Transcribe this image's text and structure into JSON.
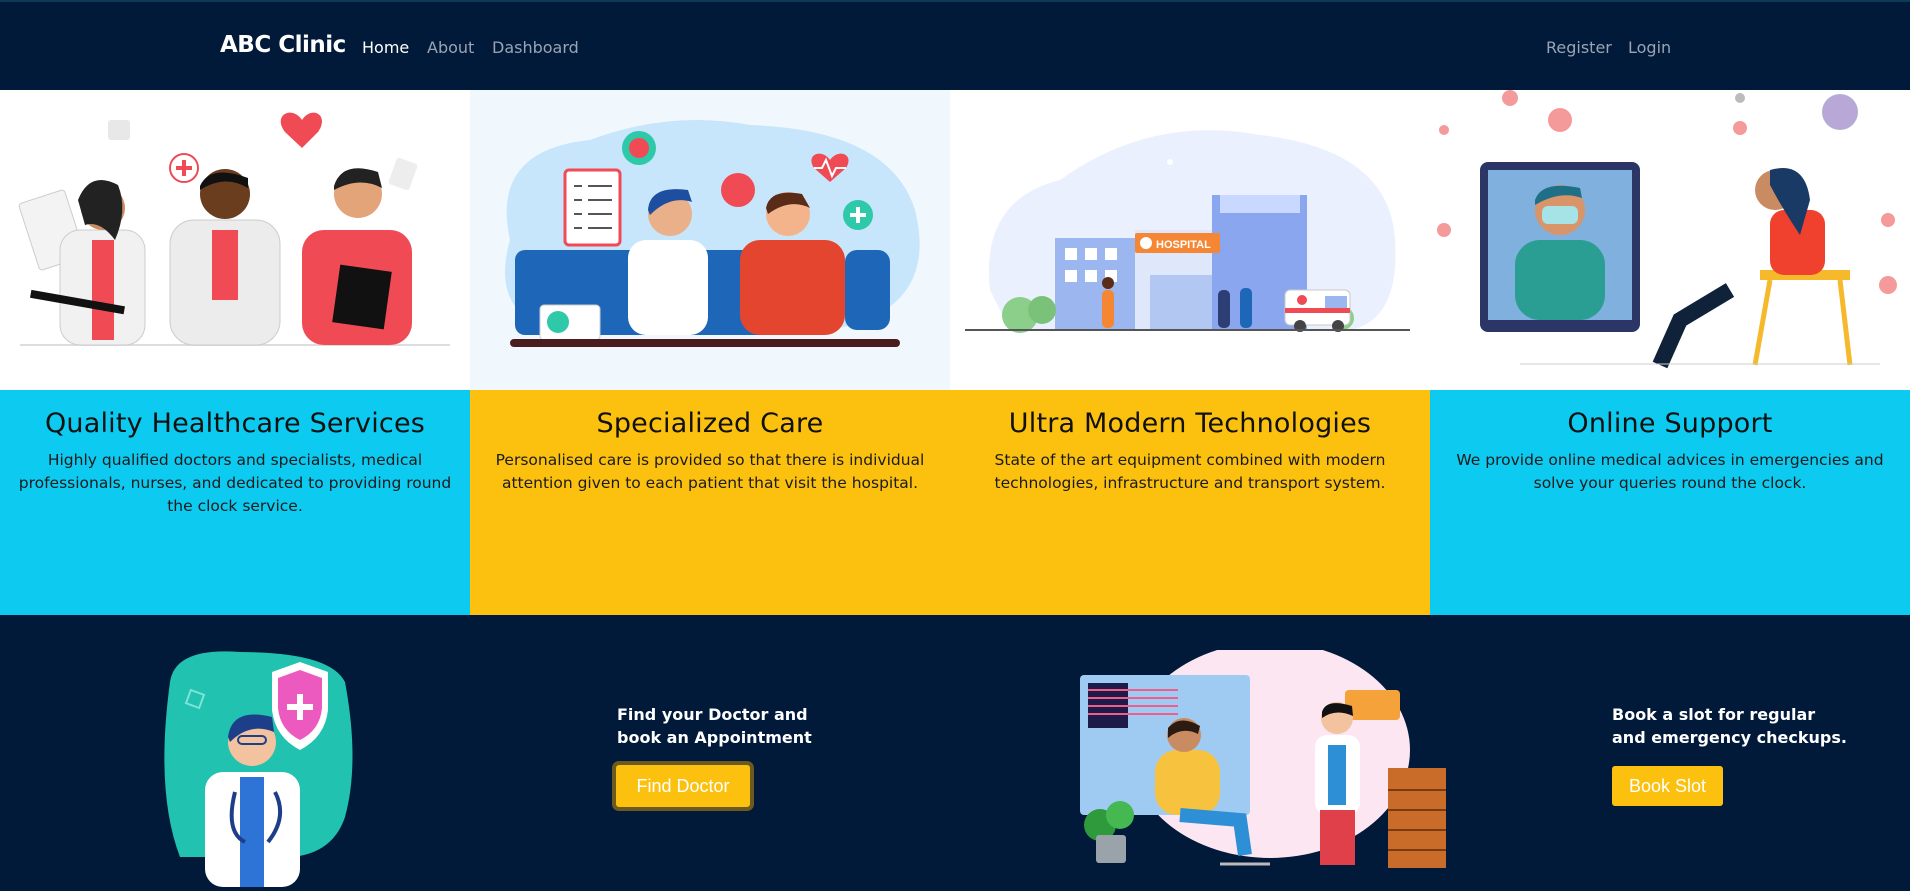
{
  "nav": {
    "brand": "ABC Clinic",
    "links": [
      "Home",
      "About",
      "Dashboard"
    ],
    "right_links": [
      "Register",
      "Login"
    ]
  },
  "features": [
    {
      "title": "Quality Healthcare Services",
      "text": "Highly qualified doctors and specialists, medical professionals, nurses, and dedicated to providing round the clock service.",
      "color": "#0dcaf0"
    },
    {
      "title": "Specialized Care",
      "text": "Personalised care is provided so that there is individual attention given to each patient that visit the hospital.",
      "color": "#fcc10f"
    },
    {
      "title": "Ultra Modern Technologies",
      "text": "State of the art equipment combined with modern technologies, infrastructure and transport system.",
      "color": "#fcc10f"
    },
    {
      "title": "Online Support",
      "text": "We provide online medical advices in emergencies and solve your queries round the clock.",
      "color": "#0dcaf0"
    }
  ],
  "illustrations": {
    "hospital_sign": "HOSPITAL"
  },
  "cta": [
    {
      "line1": "Find your Doctor and",
      "line2": "book an Appointment",
      "button": "Find Doctor"
    },
    {
      "line1": "Book a slot for regular",
      "line2": "and emergency checkups.",
      "button": "Book Slot"
    }
  ]
}
